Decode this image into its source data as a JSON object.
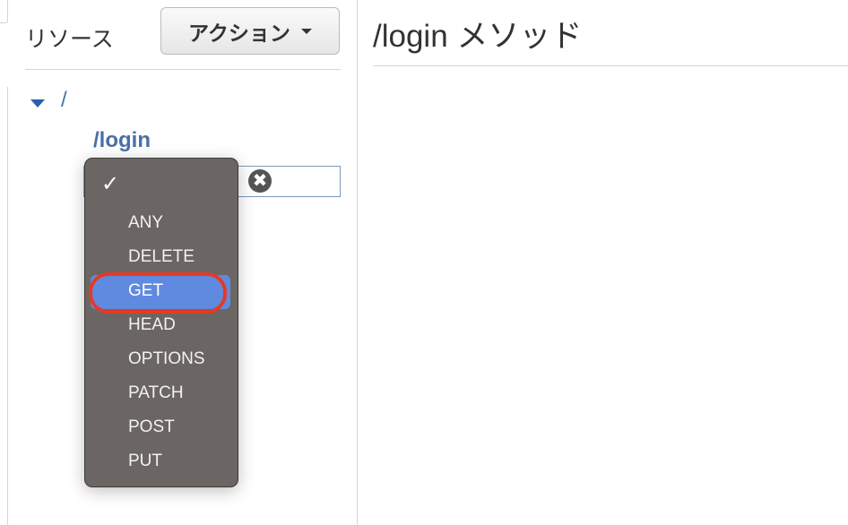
{
  "sidebar": {
    "title": "リソース",
    "action_button": "アクション",
    "tree": {
      "root": "/",
      "child": "/login"
    }
  },
  "main": {
    "title": "/login メソッド"
  },
  "method_dropdown": {
    "checkmark": "✓",
    "clear_icon": "✖",
    "options": [
      "ANY",
      "DELETE",
      "GET",
      "HEAD",
      "OPTIONS",
      "PATCH",
      "POST",
      "PUT"
    ],
    "highlighted": "GET",
    "highlight_color": "#5f8ae0",
    "annotation_color": "#e53a24"
  }
}
